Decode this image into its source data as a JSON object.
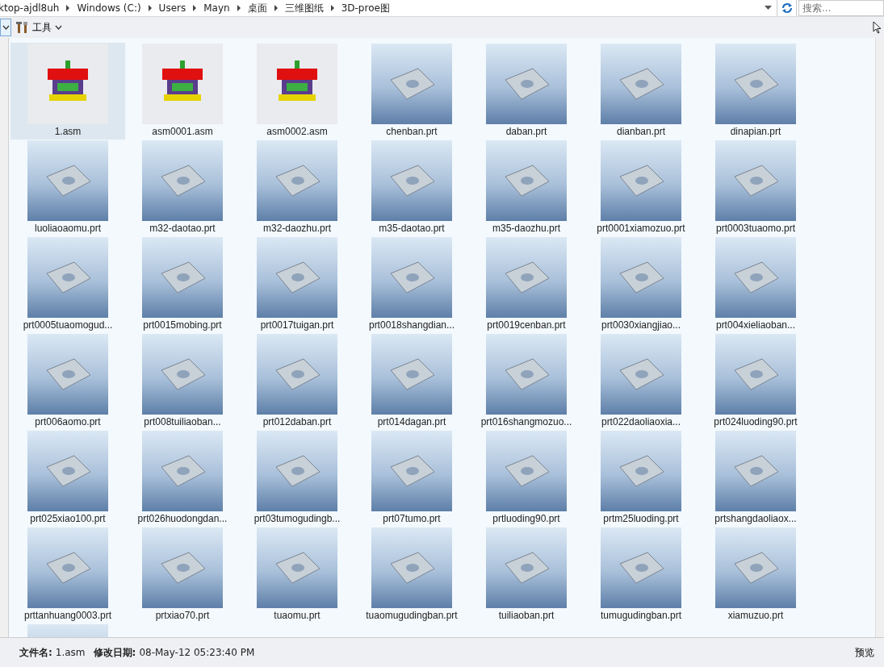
{
  "address_bar": {
    "breadcrumbs": [
      "ktop-ajdl8uh",
      "Windows (C:)",
      "Users",
      "Mayn",
      "桌面",
      "三维图纸",
      "3D-proe图"
    ],
    "search": {
      "placeholder": "搜索..."
    }
  },
  "toolbar": {
    "tools_label": "工具"
  },
  "files": [
    {
      "name": "1.asm",
      "kind": "asm",
      "selected": true
    },
    {
      "name": "asm0001.asm",
      "kind": "asm",
      "selected": false
    },
    {
      "name": "asm0002.asm",
      "kind": "asm",
      "selected": false
    },
    {
      "name": "chenban.prt",
      "kind": "prt",
      "selected": false
    },
    {
      "name": "daban.prt",
      "kind": "prt",
      "selected": false
    },
    {
      "name": "dianban.prt",
      "kind": "prt",
      "selected": false
    },
    {
      "name": "dinapian.prt",
      "kind": "prt",
      "selected": false
    },
    {
      "name": "luoliaoaomu.prt",
      "kind": "prt",
      "selected": false
    },
    {
      "name": "m32-daotao.prt",
      "kind": "prt",
      "selected": false
    },
    {
      "name": "m32-daozhu.prt",
      "kind": "prt",
      "selected": false
    },
    {
      "name": "m35-daotao.prt",
      "kind": "prt",
      "selected": false
    },
    {
      "name": "m35-daozhu.prt",
      "kind": "prt",
      "selected": false
    },
    {
      "name": "prt0001xiamozuo.prt",
      "kind": "prt",
      "selected": false
    },
    {
      "name": "prt0003tuaomo.prt",
      "kind": "prt",
      "selected": false
    },
    {
      "name": "prt0005tuaomogud...",
      "kind": "prt",
      "selected": false
    },
    {
      "name": "prt0015mobing.prt",
      "kind": "prt",
      "selected": false
    },
    {
      "name": "prt0017tuigan.prt",
      "kind": "prt",
      "selected": false
    },
    {
      "name": "prt0018shangdian...",
      "kind": "prt",
      "selected": false
    },
    {
      "name": "prt0019cenban.prt",
      "kind": "prt",
      "selected": false
    },
    {
      "name": "prt0030xiangjiao...",
      "kind": "prt",
      "selected": false
    },
    {
      "name": "prt004xieliaoban...",
      "kind": "prt",
      "selected": false
    },
    {
      "name": "prt006aomo.prt",
      "kind": "prt",
      "selected": false
    },
    {
      "name": "prt008tuiliaoban...",
      "kind": "prt",
      "selected": false
    },
    {
      "name": "prt012daban.prt",
      "kind": "prt",
      "selected": false
    },
    {
      "name": "prt014dagan.prt",
      "kind": "prt",
      "selected": false
    },
    {
      "name": "prt016shangmozuo...",
      "kind": "prt",
      "selected": false
    },
    {
      "name": "prt022daoliaoxia...",
      "kind": "prt",
      "selected": false
    },
    {
      "name": "prt024luoding90.prt",
      "kind": "prt",
      "selected": false
    },
    {
      "name": "prt025xiao100.prt",
      "kind": "prt",
      "selected": false
    },
    {
      "name": "prt026huodongdan...",
      "kind": "prt",
      "selected": false
    },
    {
      "name": "prt03tumogudingb...",
      "kind": "prt",
      "selected": false
    },
    {
      "name": "prt07tumo.prt",
      "kind": "prt",
      "selected": false
    },
    {
      "name": "prtluoding90.prt",
      "kind": "prt",
      "selected": false
    },
    {
      "name": "prtm25luoding.prt",
      "kind": "prt",
      "selected": false
    },
    {
      "name": "prtshangdaoliaox...",
      "kind": "prt",
      "selected": false
    },
    {
      "name": "prttanhuang0003.prt",
      "kind": "prt",
      "selected": false
    },
    {
      "name": "prtxiao70.prt",
      "kind": "prt",
      "selected": false
    },
    {
      "name": "tuaomu.prt",
      "kind": "prt",
      "selected": false
    },
    {
      "name": "tuaomugudingban.prt",
      "kind": "prt",
      "selected": false
    },
    {
      "name": "tuiliaoban.prt",
      "kind": "prt",
      "selected": false
    },
    {
      "name": "tumugudingban.prt",
      "kind": "prt",
      "selected": false
    },
    {
      "name": "xiamuzuo.prt",
      "kind": "prt",
      "selected": false
    },
    {
      "kind": "prt",
      "selected": false
    }
  ],
  "status_bar": {
    "file_name_label": "文件名:",
    "file_name": "1.asm",
    "modified_label": "修改日期:",
    "modified": "08-May-12 05:23:40 PM",
    "preview_button": "预览"
  }
}
